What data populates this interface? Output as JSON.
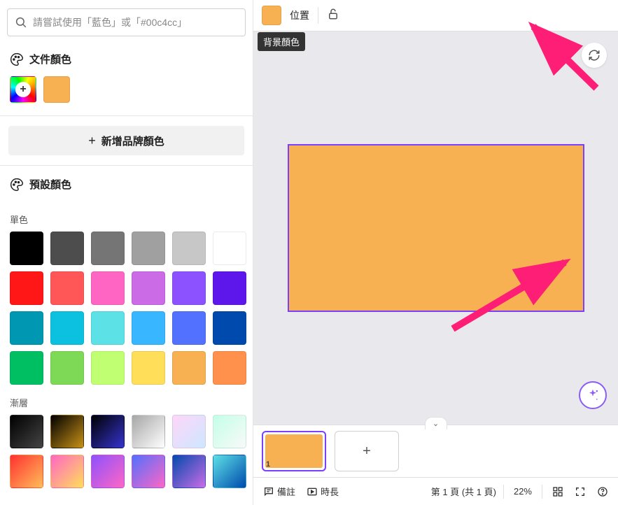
{
  "search": {
    "placeholder": "請嘗試使用「藍色」或「#00c4cc」"
  },
  "document_colors": {
    "title": "文件顏色",
    "swatch": "#f7b052"
  },
  "brand_button": "新增品牌顏色",
  "default_colors": {
    "title": "預設顏色",
    "solid_label": "單色",
    "gradient_label": "漸層",
    "solid_colors": [
      "#000000",
      "#4d4d4d",
      "#757575",
      "#a0a0a0",
      "#c7c7c7",
      "#ffffff",
      "#ff1616",
      "#ff5757",
      "#ff66c4",
      "#cb6ce6",
      "#8c52ff",
      "#5e17eb",
      "#0097b2",
      "#0cc0df",
      "#5ce1e6",
      "#38b6ff",
      "#5271ff",
      "#004aad",
      "#00bf63",
      "#7ed957",
      "#c1ff72",
      "#ffde59",
      "#f7b052",
      "#ff914d"
    ],
    "gradients": [
      [
        "#000000",
        "#444444"
      ],
      [
        "#000000",
        "#c89116"
      ],
      [
        "#000000",
        "#3533cd"
      ],
      [
        "#a6a6a6",
        "#ffffff"
      ],
      [
        "#ffd6f9",
        "#cde7ff"
      ],
      [
        "#c3ffe8",
        "#f9f9f9"
      ],
      [
        "#ff3131",
        "#ffbd59"
      ],
      [
        "#ff66c4",
        "#ffde59"
      ],
      [
        "#8c52ff",
        "#ff66c4"
      ],
      [
        "#5170ff",
        "#ff66c4"
      ],
      [
        "#004aad",
        "#cb6ce6"
      ],
      [
        "#5de0e6",
        "#004aad"
      ]
    ]
  },
  "topbar": {
    "position_label": "位置",
    "tooltip": "背景顏色",
    "bg_color": "#f7b052"
  },
  "canvas": {
    "page_bg": "#f7b052"
  },
  "page_strip": {
    "page_number": "1"
  },
  "bottombar": {
    "notes": "備註",
    "duration": "時長",
    "page_counter": "第 1 頁 (共 1 頁)",
    "zoom": "22%"
  }
}
